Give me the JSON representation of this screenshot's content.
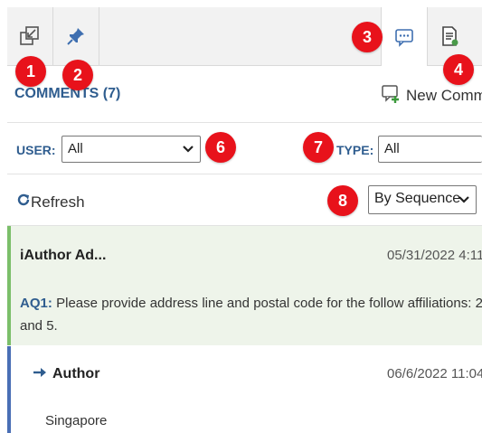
{
  "toolbar": {
    "buttons": [
      {
        "id": "collapse",
        "icon": "collapse-arrow-icon"
      },
      {
        "id": "pin",
        "icon": "pin-icon"
      },
      {
        "id": "comments",
        "icon": "comment-bubble-icon",
        "active": true
      },
      {
        "id": "document",
        "icon": "document-icon"
      }
    ]
  },
  "markers": [
    "1",
    "2",
    "3",
    "4",
    "6",
    "7",
    "8"
  ],
  "header": {
    "comments_label": "COMMENTS (7)",
    "new_comment_label": "New Comm"
  },
  "filters": {
    "user_label": "USER:",
    "user_value": "All",
    "type_label": "TYPE:",
    "type_value": "All"
  },
  "actions": {
    "refresh_label": "Refresh",
    "sort_value": "By Sequence"
  },
  "comment": {
    "author": "iAuthor Ad...",
    "date": "05/31/2022 4:11",
    "id_label": "AQ1:",
    "text": "Please provide address line and postal code for the follow affiliations: 2 and 5."
  },
  "reply": {
    "author": "Author",
    "date": "06/6/2022 11:04",
    "text": "Singapore"
  },
  "colors": {
    "accent_blue": "#2f5d8f",
    "marker_red": "#e8121b",
    "comment_green_border": "#7bbf6a",
    "reply_blue_border": "#4a6fb5"
  }
}
